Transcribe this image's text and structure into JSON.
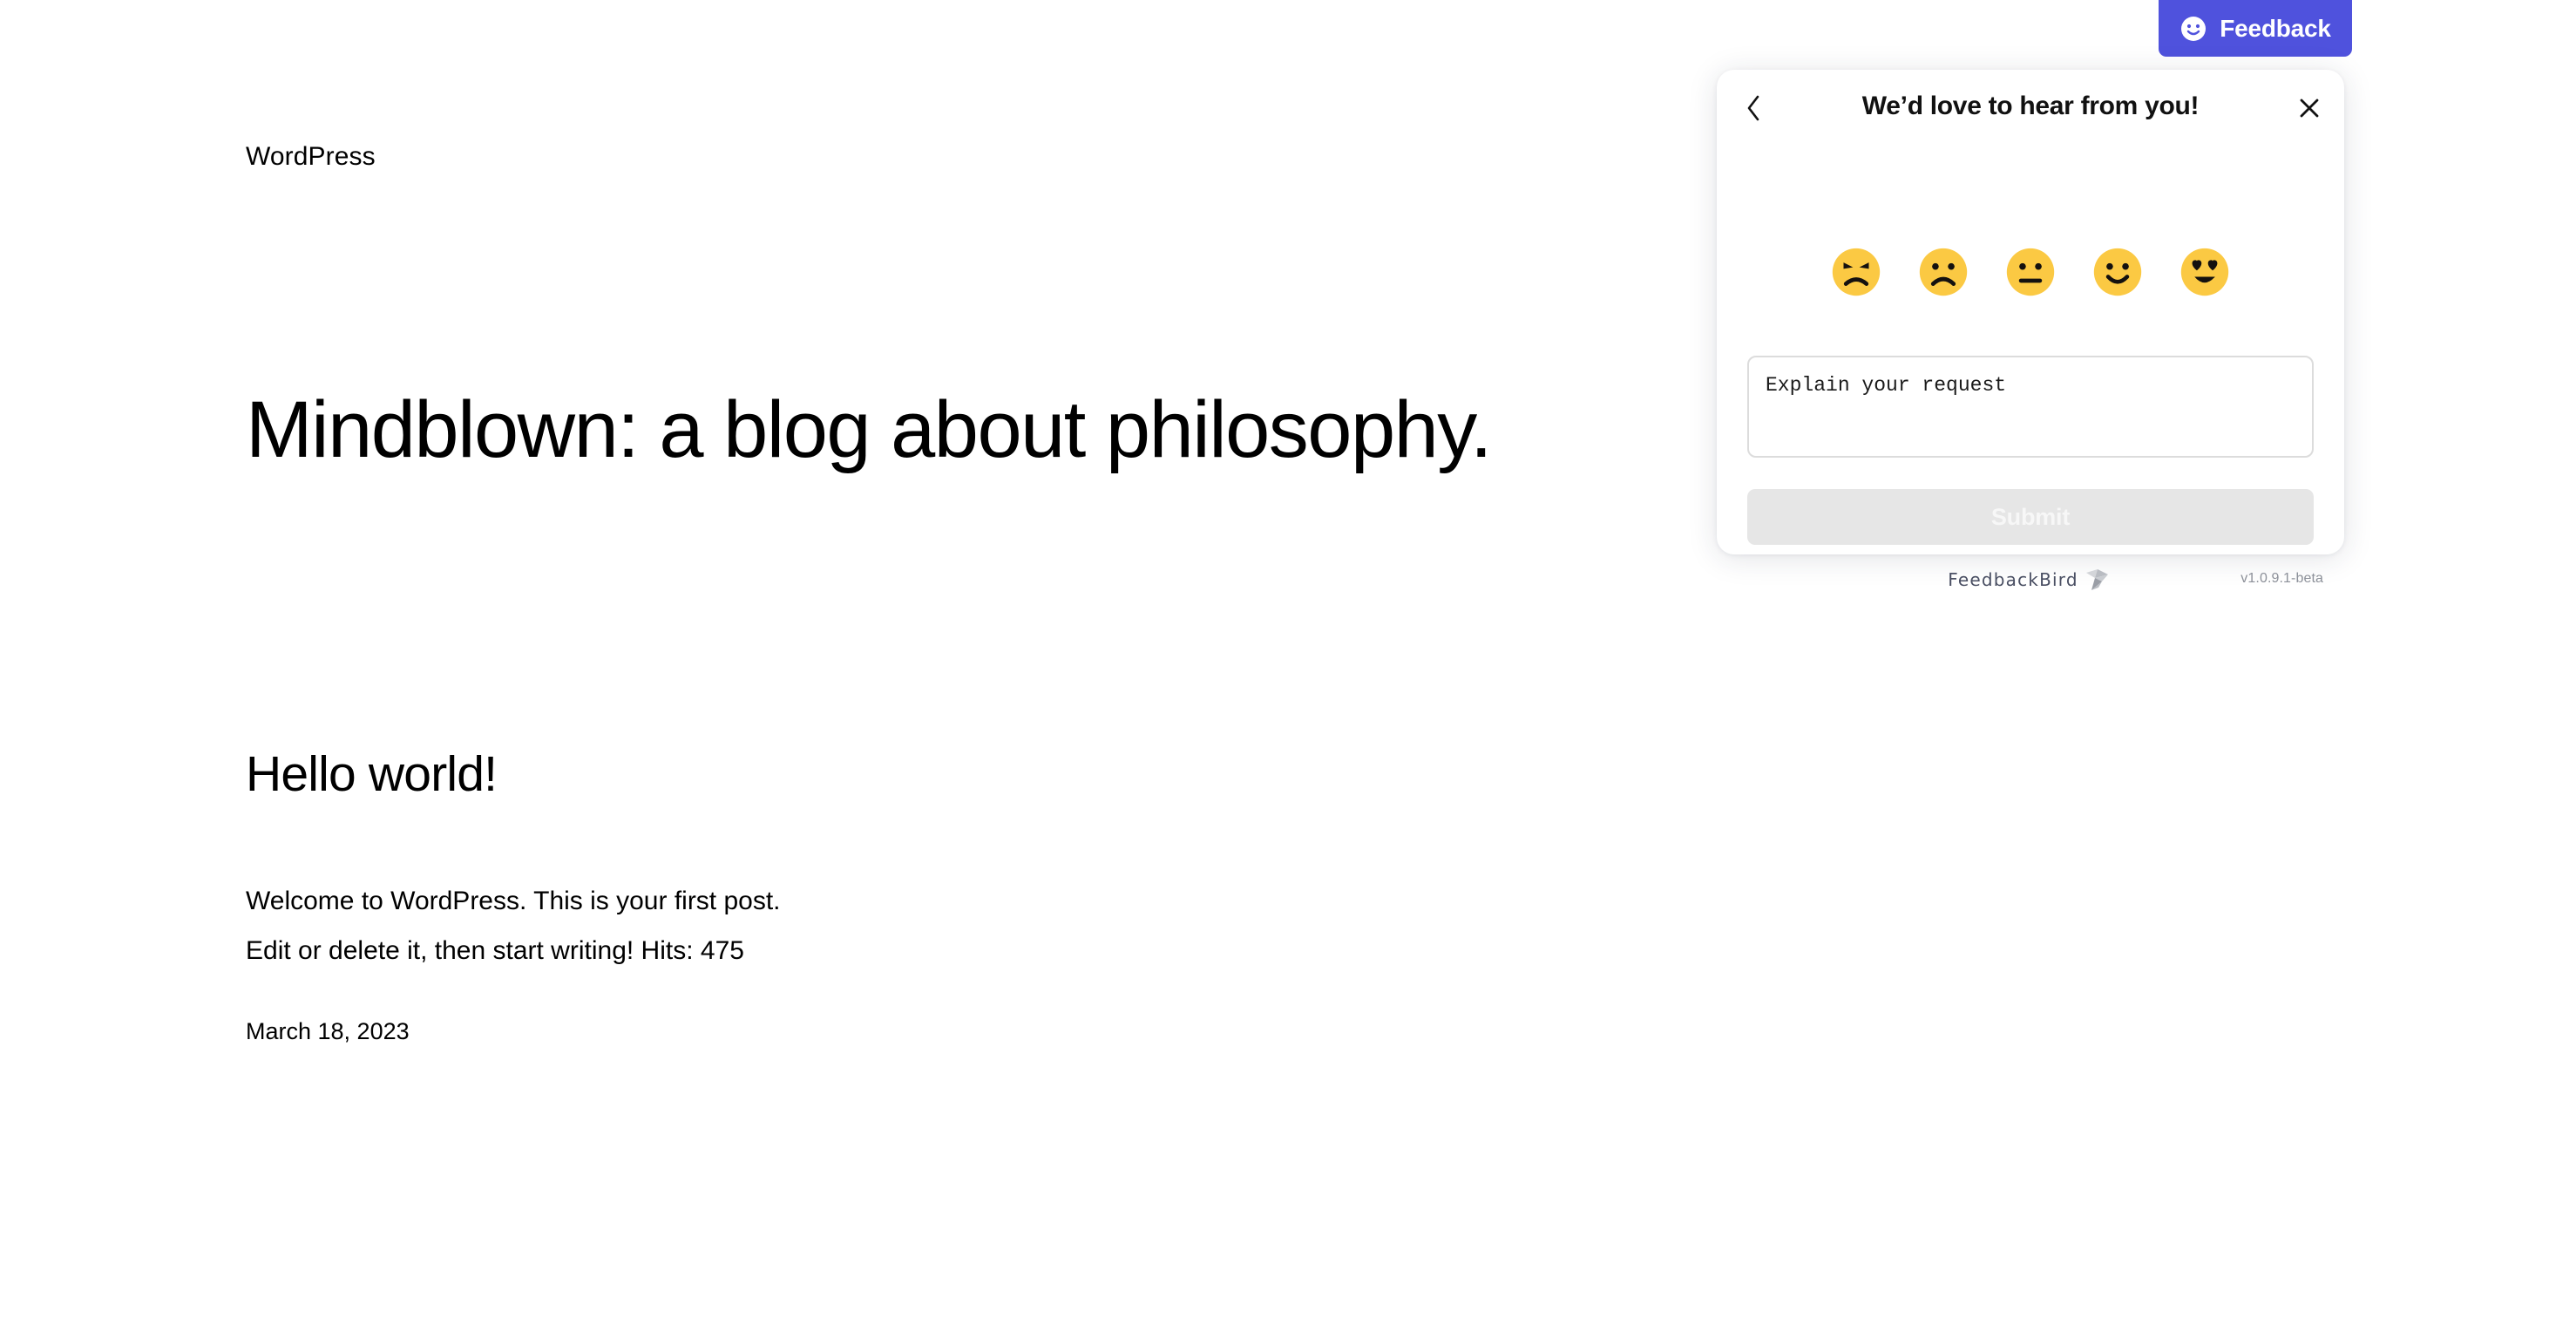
{
  "page": {
    "site_title": "WordPress",
    "hero_heading": "Mindblown: a blog about philosophy.",
    "post": {
      "title": "Hello world!",
      "body_line_1": "Welcome to WordPress. This is your first post.",
      "body_line_2": "Edit or delete it, then start writing! Hits: 475",
      "date": "March 18, 2023"
    }
  },
  "launcher": {
    "label": "Feedback",
    "icon": "smiley-face-icon",
    "color": "#4f52dd"
  },
  "widget": {
    "title": "We’d love to hear from you!",
    "back_icon": "chevron-left-icon",
    "close_icon": "close-icon",
    "ratings": [
      {
        "name": "angry",
        "icon": "angry-face-icon",
        "value": 1
      },
      {
        "name": "sad",
        "icon": "sad-face-icon",
        "value": 2
      },
      {
        "name": "neutral",
        "icon": "neutral-face-icon",
        "value": 3
      },
      {
        "name": "happy",
        "icon": "smiling-face-icon",
        "value": 4
      },
      {
        "name": "love",
        "icon": "heart-eyes-face-icon",
        "value": 5
      }
    ],
    "emoji_color": "#fbc943",
    "explain": {
      "value": "",
      "placeholder": "Explain your request"
    },
    "submit_label": "Submit",
    "submit_disabled": true,
    "footer": {
      "brand": "FeedbackBird",
      "brand_icon": "origami-bird-logo",
      "version": "v1.0.9.1-beta"
    }
  }
}
